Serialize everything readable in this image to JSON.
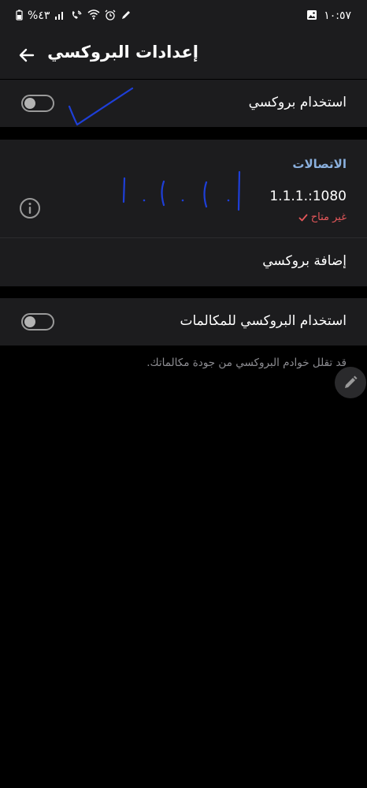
{
  "status_bar": {
    "time": "١٠:٥٧",
    "battery": "%٤٣",
    "icons": [
      "battery-icon",
      "signal-icon",
      "wifi-call-icon",
      "wifi-icon",
      "alarm-icon",
      "edit-icon",
      "gallery-icon"
    ]
  },
  "header": {
    "title": "إعدادات البروكسي",
    "back_icon": "arrow-left-icon"
  },
  "use_proxy": {
    "label": "استخدام بروكسي",
    "enabled": false
  },
  "connections": {
    "header": "الاتصالات",
    "items": [
      {
        "address": "1.1.1.:1080",
        "status": "غير متاح"
      }
    ],
    "add_label": "إضافة بروكسي"
  },
  "calls_proxy": {
    "label": "استخدام البروكسي للمكالمات",
    "enabled": false,
    "hint": "قد تقلل خوادم البروكسي من جودة مكالماتك."
  },
  "colors": {
    "accent": "#8ab0de",
    "error": "#e4575a",
    "surface": "#1c1c1e",
    "background": "#000000",
    "scribble": "#1e3fd8"
  }
}
